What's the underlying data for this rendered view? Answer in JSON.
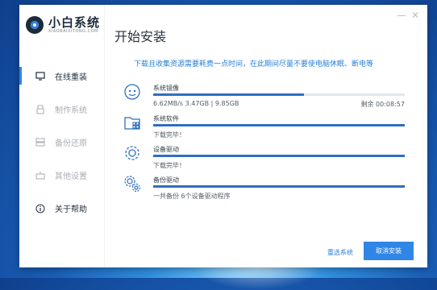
{
  "app": {
    "logo_cn": "小白系统",
    "logo_en": "XIAOBAIXITONG.COM",
    "minimize_glyph": "—",
    "close_glyph": "✕"
  },
  "sidebar": {
    "items": [
      {
        "label": "在线重装",
        "icon": "monitor-icon",
        "active": true
      },
      {
        "label": "制作系统",
        "icon": "usb-icon"
      },
      {
        "label": "备份还原",
        "icon": "backup-icon"
      },
      {
        "label": "其他设置",
        "icon": "settings-icon"
      },
      {
        "label": "关于帮助",
        "icon": "info-icon"
      }
    ]
  },
  "main": {
    "title": "开始安装",
    "notice": "下载且收集资源需要耗费一点时间，在此期间尽量不要使电脑休眠、断电等",
    "tasks": [
      {
        "name": "系统镜像",
        "icon": "download-icon",
        "progress": 0.6,
        "detail": "6.62MB/s 3.47GB | 9.85GB",
        "remaining": "剩余 00:08:57"
      },
      {
        "name": "系统软件",
        "icon": "software-icon",
        "progress": 1.0,
        "detail": "下载完毕！"
      },
      {
        "name": "设备驱动",
        "icon": "gear-icon",
        "progress": 1.0,
        "detail": "下载完毕！"
      },
      {
        "name": "备份驱动",
        "icon": "gears-icon",
        "progress": 1.0,
        "detail": "一共备份 6个设备驱动程序"
      }
    ]
  },
  "footer": {
    "reselect_label": "重选系统",
    "cancel_label": "取消安装"
  },
  "colors": {
    "accent": "#2f86e6",
    "progress": "#2f6fbf"
  }
}
